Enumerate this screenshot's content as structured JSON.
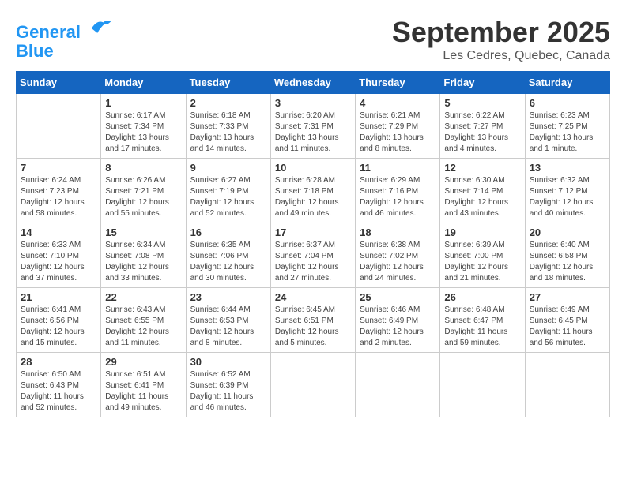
{
  "logo": {
    "line1": "General",
    "line2": "Blue"
  },
  "title": "September 2025",
  "location": "Les Cedres, Quebec, Canada",
  "days_of_week": [
    "Sunday",
    "Monday",
    "Tuesday",
    "Wednesday",
    "Thursday",
    "Friday",
    "Saturday"
  ],
  "weeks": [
    [
      {
        "day": "",
        "content": ""
      },
      {
        "day": "1",
        "content": "Sunrise: 6:17 AM\nSunset: 7:34 PM\nDaylight: 13 hours\nand 17 minutes."
      },
      {
        "day": "2",
        "content": "Sunrise: 6:18 AM\nSunset: 7:33 PM\nDaylight: 13 hours\nand 14 minutes."
      },
      {
        "day": "3",
        "content": "Sunrise: 6:20 AM\nSunset: 7:31 PM\nDaylight: 13 hours\nand 11 minutes."
      },
      {
        "day": "4",
        "content": "Sunrise: 6:21 AM\nSunset: 7:29 PM\nDaylight: 13 hours\nand 8 minutes."
      },
      {
        "day": "5",
        "content": "Sunrise: 6:22 AM\nSunset: 7:27 PM\nDaylight: 13 hours\nand 4 minutes."
      },
      {
        "day": "6",
        "content": "Sunrise: 6:23 AM\nSunset: 7:25 PM\nDaylight: 13 hours\nand 1 minute."
      }
    ],
    [
      {
        "day": "7",
        "content": "Sunrise: 6:24 AM\nSunset: 7:23 PM\nDaylight: 12 hours\nand 58 minutes."
      },
      {
        "day": "8",
        "content": "Sunrise: 6:26 AM\nSunset: 7:21 PM\nDaylight: 12 hours\nand 55 minutes."
      },
      {
        "day": "9",
        "content": "Sunrise: 6:27 AM\nSunset: 7:19 PM\nDaylight: 12 hours\nand 52 minutes."
      },
      {
        "day": "10",
        "content": "Sunrise: 6:28 AM\nSunset: 7:18 PM\nDaylight: 12 hours\nand 49 minutes."
      },
      {
        "day": "11",
        "content": "Sunrise: 6:29 AM\nSunset: 7:16 PM\nDaylight: 12 hours\nand 46 minutes."
      },
      {
        "day": "12",
        "content": "Sunrise: 6:30 AM\nSunset: 7:14 PM\nDaylight: 12 hours\nand 43 minutes."
      },
      {
        "day": "13",
        "content": "Sunrise: 6:32 AM\nSunset: 7:12 PM\nDaylight: 12 hours\nand 40 minutes."
      }
    ],
    [
      {
        "day": "14",
        "content": "Sunrise: 6:33 AM\nSunset: 7:10 PM\nDaylight: 12 hours\nand 37 minutes."
      },
      {
        "day": "15",
        "content": "Sunrise: 6:34 AM\nSunset: 7:08 PM\nDaylight: 12 hours\nand 33 minutes."
      },
      {
        "day": "16",
        "content": "Sunrise: 6:35 AM\nSunset: 7:06 PM\nDaylight: 12 hours\nand 30 minutes."
      },
      {
        "day": "17",
        "content": "Sunrise: 6:37 AM\nSunset: 7:04 PM\nDaylight: 12 hours\nand 27 minutes."
      },
      {
        "day": "18",
        "content": "Sunrise: 6:38 AM\nSunset: 7:02 PM\nDaylight: 12 hours\nand 24 minutes."
      },
      {
        "day": "19",
        "content": "Sunrise: 6:39 AM\nSunset: 7:00 PM\nDaylight: 12 hours\nand 21 minutes."
      },
      {
        "day": "20",
        "content": "Sunrise: 6:40 AM\nSunset: 6:58 PM\nDaylight: 12 hours\nand 18 minutes."
      }
    ],
    [
      {
        "day": "21",
        "content": "Sunrise: 6:41 AM\nSunset: 6:56 PM\nDaylight: 12 hours\nand 15 minutes."
      },
      {
        "day": "22",
        "content": "Sunrise: 6:43 AM\nSunset: 6:55 PM\nDaylight: 12 hours\nand 11 minutes."
      },
      {
        "day": "23",
        "content": "Sunrise: 6:44 AM\nSunset: 6:53 PM\nDaylight: 12 hours\nand 8 minutes."
      },
      {
        "day": "24",
        "content": "Sunrise: 6:45 AM\nSunset: 6:51 PM\nDaylight: 12 hours\nand 5 minutes."
      },
      {
        "day": "25",
        "content": "Sunrise: 6:46 AM\nSunset: 6:49 PM\nDaylight: 12 hours\nand 2 minutes."
      },
      {
        "day": "26",
        "content": "Sunrise: 6:48 AM\nSunset: 6:47 PM\nDaylight: 11 hours\nand 59 minutes."
      },
      {
        "day": "27",
        "content": "Sunrise: 6:49 AM\nSunset: 6:45 PM\nDaylight: 11 hours\nand 56 minutes."
      }
    ],
    [
      {
        "day": "28",
        "content": "Sunrise: 6:50 AM\nSunset: 6:43 PM\nDaylight: 11 hours\nand 52 minutes."
      },
      {
        "day": "29",
        "content": "Sunrise: 6:51 AM\nSunset: 6:41 PM\nDaylight: 11 hours\nand 49 minutes."
      },
      {
        "day": "30",
        "content": "Sunrise: 6:52 AM\nSunset: 6:39 PM\nDaylight: 11 hours\nand 46 minutes."
      },
      {
        "day": "",
        "content": ""
      },
      {
        "day": "",
        "content": ""
      },
      {
        "day": "",
        "content": ""
      },
      {
        "day": "",
        "content": ""
      }
    ]
  ]
}
